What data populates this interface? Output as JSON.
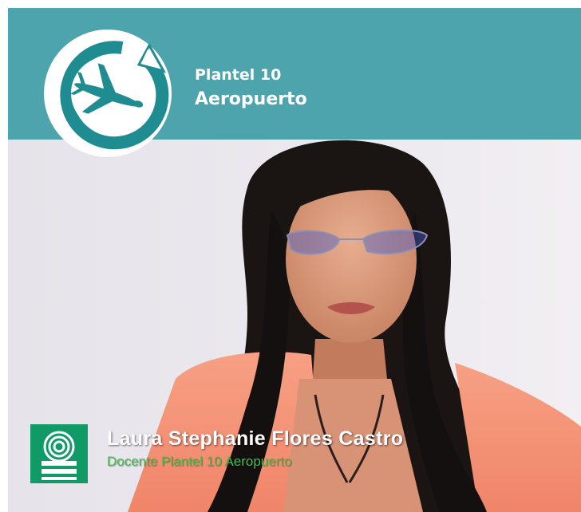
{
  "header": {
    "line1": "Plantel 10",
    "line2": "Aeropuerto",
    "logo_icon": "airplane-cycle-icon"
  },
  "lower_third": {
    "name": "Laura Stephanie Flores Castro",
    "role": "Docente Plantel 10 Aeropuerto",
    "logo_icon": "institution-spiral-logo-icon"
  },
  "colors": {
    "header_teal": "#4ea4ad",
    "logo_teal": "#1f8c92",
    "lower_logo_green": "#0f9a66",
    "role_text_green": "#3fc04a",
    "jacket_coral": "#f59076"
  }
}
